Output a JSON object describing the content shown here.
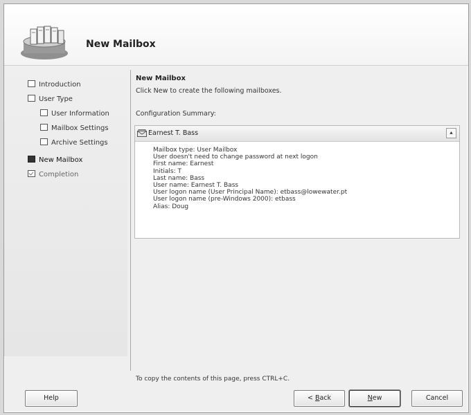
{
  "header": {
    "title": "New Mailbox",
    "icon": "mailbox-server-icon"
  },
  "sidebar": {
    "items": [
      {
        "label": "Introduction",
        "state": "pending",
        "indent": false
      },
      {
        "label": "User Type",
        "state": "pending",
        "indent": false
      },
      {
        "label": "User Information",
        "state": "pending",
        "indent": true
      },
      {
        "label": "Mailbox Settings",
        "state": "pending",
        "indent": true
      },
      {
        "label": "Archive Settings",
        "state": "pending",
        "indent": true
      },
      {
        "label": "New Mailbox",
        "state": "current",
        "indent": false
      },
      {
        "label": "Completion",
        "state": "complete",
        "indent": false
      }
    ]
  },
  "main": {
    "section_title": "New Mailbox",
    "description": "Click New to create the following mailboxes.",
    "summary_label": "Configuration Summary:",
    "mailbox_name": "Earnest T. Bass",
    "details": [
      "Mailbox type: User Mailbox",
      "User doesn't need to change password at next logon",
      "First name: Earnest",
      "Initials: T",
      "Last name: Bass",
      "User name: Earnest T. Bass",
      "User logon name (User Principal Name): etbass@lowewater.pt",
      "User logon name (pre-Windows 2000): etbass",
      "Alias: Doug"
    ],
    "collapse_glyph": "⯅"
  },
  "footer": {
    "hint": "To copy the contents of this page, press CTRL+C.",
    "help": "Help",
    "back_prefix": "< ",
    "back_accel": "B",
    "back_rest": "ack",
    "new_accel": "N",
    "new_rest": "ew",
    "cancel": "Cancel"
  }
}
